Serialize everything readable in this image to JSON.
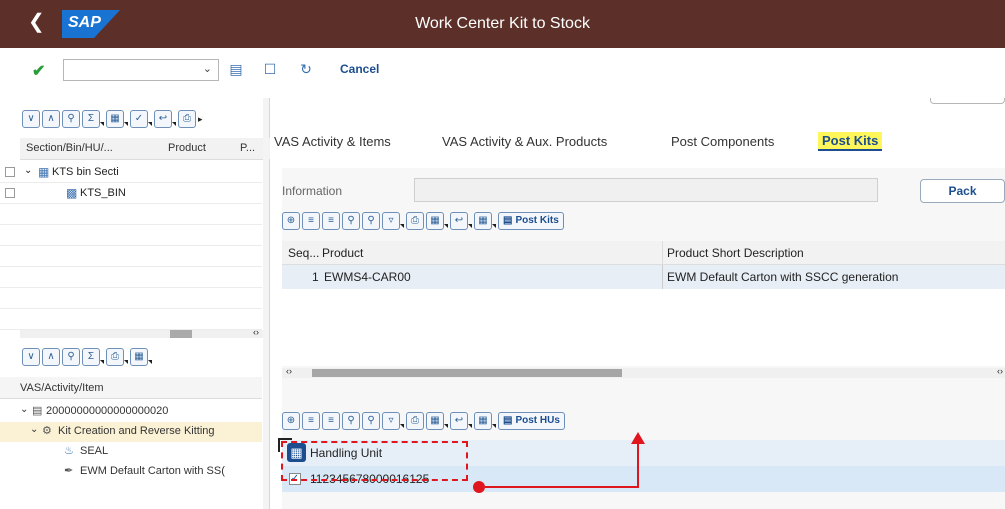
{
  "shell": {
    "title": "Work Center Kit to Stock",
    "logo": "SAP"
  },
  "toolbar": {
    "select_value": "",
    "cancel_label": "Cancel"
  },
  "left_tree": {
    "headers": [
      "Section/Bin/HU/...",
      "Product",
      "P..."
    ],
    "rows": [
      {
        "label": "KTS bin Secti"
      },
      {
        "label": "KTS_BIN"
      }
    ]
  },
  "activity_tree": {
    "header": "VAS/Activity/Item",
    "rows": [
      {
        "label": "20000000000000000020"
      },
      {
        "label": "Kit Creation and Reverse Kitting"
      },
      {
        "label": "SEAL"
      },
      {
        "label": "EWM Default Carton with SS("
      }
    ]
  },
  "tabs": [
    {
      "label": "VAS Activity & Items"
    },
    {
      "label": "VAS Activity & Aux. Products"
    },
    {
      "label": "Post Components"
    },
    {
      "label": "Post Kits"
    }
  ],
  "info": {
    "label": "Information",
    "value": ""
  },
  "pack_label": "Pack",
  "grid1": {
    "toolbar_button": "Post Kits",
    "headers": [
      "Seq...",
      "Product",
      "Product Short Description"
    ],
    "rows": [
      {
        "seq": "1",
        "product": "EWMS4-CAR00",
        "description": "EWM Default Carton with SSCC generation"
      }
    ]
  },
  "grid2": {
    "toolbar_button": "Post HUs",
    "header": "Handling Unit",
    "rows": [
      {
        "hu": "112345678000016125"
      }
    ]
  },
  "colors": {
    "shell": "#5c3028",
    "highlight": "#fff65a",
    "annotation": "#e0161f",
    "link": "#1c4e8f"
  }
}
